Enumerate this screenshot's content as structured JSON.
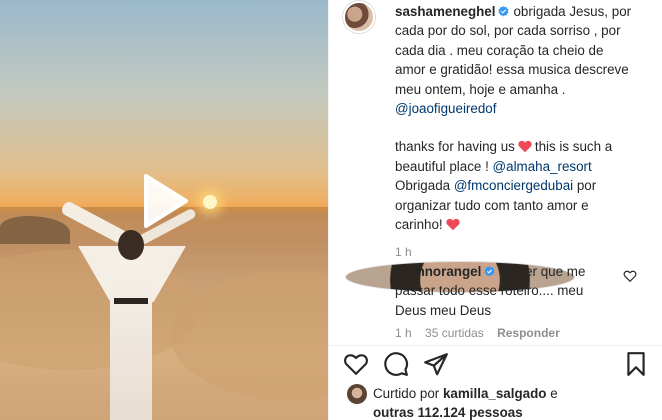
{
  "post": {
    "author": "sasha",
    "author_full": "sashameneghel",
    "caption_lines": [
      "obrigada Jesus, por",
      "cada por do sol, por cada sorriso , por",
      "cada dia . meu coração ta cheio de",
      "amor e gratidão! essa musica descreve",
      "meu ontem, hoje e amanha ."
    ],
    "mention_music": "@joaofigueiredof",
    "thanks_line1": "thanks for having us",
    "thanks_line1b": "this is such a",
    "thanks_line2": "beautiful place !",
    "mention_resort": "@almaha_resort",
    "obrigada_prefix": "Obrigada",
    "mention_concierge": "@fmconciergedubai",
    "obrigada_suffix": "por",
    "closing_line1": "organizar tudo com tanto amor e",
    "closing_line2": "carinho!",
    "time": "1 h"
  },
  "comment": {
    "author": "brunnorangel",
    "text_lines": [
      "Vai ter que me",
      "passar todo esse roteiro.... meu",
      "Deus meu Deus"
    ],
    "meta_time": "1 h",
    "meta_likes": "35 curtidas",
    "meta_reply": "Responder"
  },
  "likes": {
    "prefix": "Curtido por",
    "user": "kamilla_salgado",
    "connector": "e",
    "others_prefix": "outras",
    "others_count": "112.124",
    "others_suffix": "pessoas"
  },
  "icons": {
    "play": "play-icon",
    "verified": "verified-badge-icon",
    "heart": "heart-icon",
    "comment": "comment-icon",
    "share": "share-icon",
    "save": "bookmark-icon"
  },
  "colors": {
    "link": "#00376b",
    "verified": "#3897f0",
    "heart_red": "#ed4956",
    "muted": "#8e8e8e"
  }
}
